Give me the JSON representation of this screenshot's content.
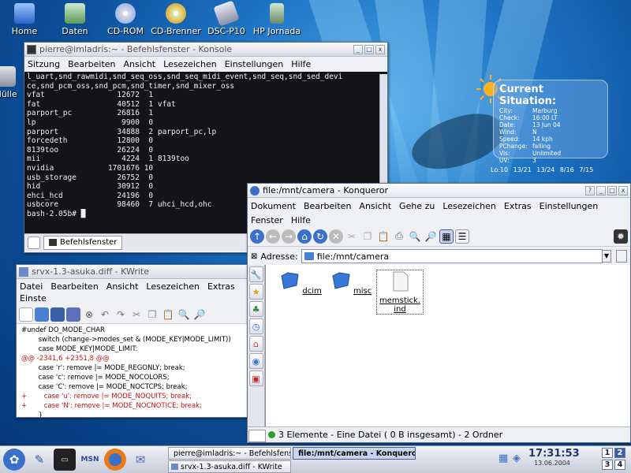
{
  "desktop_icons": [
    {
      "label": "Home",
      "icon": "home-icon"
    },
    {
      "label": "Daten",
      "icon": "data-icon"
    },
    {
      "label": "CD-ROM",
      "icon": "cdrom-icon"
    },
    {
      "label": "CD-Brenner",
      "icon": "cdburner-icon"
    },
    {
      "label": "DSC-P10",
      "icon": "camera-icon"
    },
    {
      "label": "HP Jornada",
      "icon": "pda-icon"
    },
    {
      "label": "Mülle",
      "icon": "trash-icon"
    }
  ],
  "konsole": {
    "title": "pierre@imladris:~ - Befehlsfenster - Konsole",
    "menu": [
      "Sitzung",
      "Bearbeiten",
      "Ansicht",
      "Lesezeichen",
      "Einstellungen",
      "Hilfe"
    ],
    "lines": [
      "l_uart,snd_rawmidi,snd_seq_oss,snd_seq_midi_event,snd_seq,snd_sed_devi",
      "ce,snd_pcm_oss,snd_pcm,snd_timer,snd_mixer_oss",
      "vfat                12672  1",
      "fat                 40512  1 vfat",
      "parport_pc          26816  1",
      "lp                   9900  0",
      "parport             34888  2 parport_pc,lp",
      "forcedeth           12800  0",
      "8139too             26224  0",
      "mii                  4224  1 8139too",
      "nvidia            1701676 10",
      "usb_storage         26752  0",
      "hid                 30912  0",
      "ehci_hcd            24196  0",
      "usbcore             98460  7 uhci_hcd,ohc",
      "bash-2.05b# █"
    ],
    "tab_label": "Befehlsfenster"
  },
  "kwrite": {
    "title": "srvx-1.3-asuka.diff - KWrite",
    "menu": [
      "Datei",
      "Bearbeiten",
      "Ansicht",
      "Lesezeichen",
      "Extras",
      "Einste"
    ],
    "lines": [
      {
        "text": "#undef DO_MODE_CHAR",
        "color": "#000000"
      },
      {
        "text": "        switch (change->modes_set & (MODE_KEY|MODE_LIMIT))",
        "color": "#000000"
      },
      {
        "text": "        case MODE_KEY|MODE_LIMIT:",
        "color": "#000000"
      },
      {
        "text": "@@ -2341,6 +2351,8 @@",
        "color": "#cc1010"
      },
      {
        "text": "        case 'r': remove |= MODE_REGONLY; break;",
        "color": "#000000"
      },
      {
        "text": "        case 'c': remove |= MODE_NOCOLORS;",
        "color": "#000000"
      },
      {
        "text": "        case 'C': remove |= MODE_NOCTCPS; break;",
        "color": "#000000"
      },
      {
        "text": "+        case 'u': remove |= MODE_NOQUITS; break;",
        "color": "#cc1010"
      },
      {
        "text": "+        case 'N': remove |= MODE_NOCNOTICE; break;",
        "color": "#cc1010"
      },
      {
        "text": "        }",
        "color": "#000000"
      }
    ]
  },
  "konqueror": {
    "title": "file:/mnt/camera - Konqueror",
    "menu": [
      "Dokument",
      "Bearbeiten",
      "Ansicht",
      "Gehe zu",
      "Lesezeichen",
      "Extras",
      "Einstellungen",
      "Fenster",
      "Hilfe"
    ],
    "address_label": "Adresse:",
    "address_value": "file:/mnt/camera",
    "files": [
      {
        "name": "dcim",
        "type": "folder"
      },
      {
        "name": "misc",
        "type": "folder"
      },
      {
        "name": "memstick.\nind",
        "type": "file"
      }
    ],
    "status": "3 Elemente - Eine Datei ( 0 B insgesamt) - 2 Ordner"
  },
  "weather": {
    "heading": "Current Situation:",
    "rows": [
      {
        "k": "City:",
        "v": "Marburg"
      },
      {
        "k": "Check:",
        "v": "16:00 LT"
      },
      {
        "k": "Date:",
        "v": "13 Jun 04"
      },
      {
        "k": "Wind:",
        "v": "N"
      },
      {
        "k": "Speed:",
        "v": "14 kph"
      },
      {
        "k": "PChange:",
        "v": "falling"
      },
      {
        "k": "Vis:",
        "v": "Unlimited"
      },
      {
        "k": "UV:",
        "v": "3"
      }
    ],
    "forecast": "Lo:10 13/21 13/24 8/16 7/15"
  },
  "taskbar": {
    "tasks": [
      {
        "label": "pierre@imladris:~ - Befehlsfens",
        "active": false
      },
      {
        "label": "file:/mnt/camera - Konqueror",
        "active": true
      },
      {
        "label": "srvx-1.3-asuka.diff - KWrite",
        "active": false
      }
    ],
    "time": "17:31:53",
    "date": "13.06.2004",
    "desktops": [
      "1",
      "2",
      "3",
      "4"
    ]
  }
}
